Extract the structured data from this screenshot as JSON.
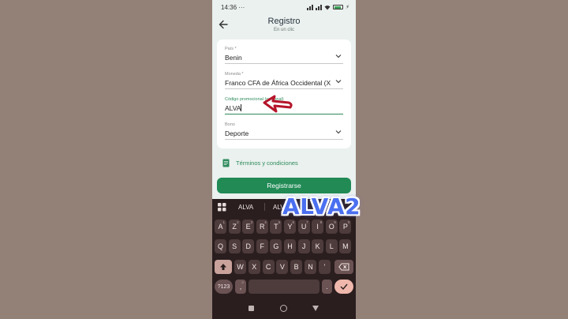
{
  "status_bar": {
    "time": "14:36",
    "dots": "···",
    "battery": "86"
  },
  "header": {
    "title": "Registro",
    "subtitle": "En un clic"
  },
  "form": {
    "country_label": "País *",
    "country_value": "Benin",
    "currency_label": "Moneda *",
    "currency_value": "Franco CFA de África Occidental (X",
    "promo_label": "Código promocional (opcional)",
    "promo_value": "ALVA",
    "bonus_label": "Bono",
    "bonus_value": "Deporte"
  },
  "terms_label": "Términos y condiciones",
  "register_button": "Registrarse",
  "keyboard": {
    "suggestions": [
      "ALVA",
      "ALV"
    ],
    "row1": [
      {
        "k": "A",
        "s": "1"
      },
      {
        "k": "Z",
        "s": "2"
      },
      {
        "k": "E",
        "s": "3"
      },
      {
        "k": "R",
        "s": "4"
      },
      {
        "k": "T",
        "s": "5"
      },
      {
        "k": "Y",
        "s": "6"
      },
      {
        "k": "U",
        "s": "7"
      },
      {
        "k": "I",
        "s": "8"
      },
      {
        "k": "O",
        "s": "9"
      },
      {
        "k": "P",
        "s": "0"
      }
    ],
    "row2": [
      "Q",
      "S",
      "D",
      "F",
      "G",
      "H",
      "J",
      "K",
      "L",
      "M"
    ],
    "row3": [
      "W",
      "X",
      "C",
      "V",
      "B",
      "N",
      "'"
    ],
    "numbers_key": "?123",
    "comma_key": ",",
    "period_key": "."
  },
  "overlay_text": "ALVA2",
  "colors": {
    "accent": "#218a55",
    "keyboard_bg": "#2a1e1f",
    "annotation": "#b5152a",
    "overlay": "#4a6ff0"
  }
}
